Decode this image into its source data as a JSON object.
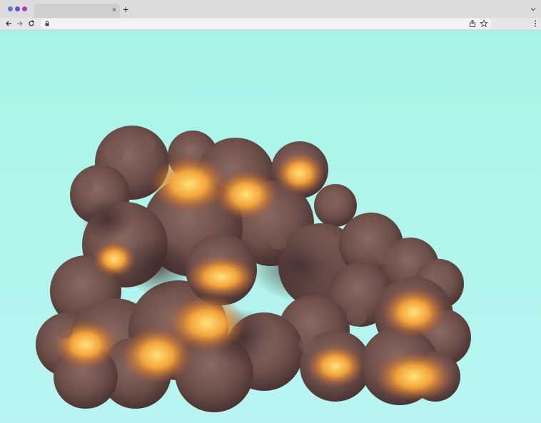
{
  "browser": {
    "tab_close_glyph": "×",
    "new_tab_glyph": "+",
    "traffic_colors": [
      "#4f7bd6",
      "#6a4ed0",
      "#b13ac9"
    ],
    "icons": {
      "back": "arrow-left-icon",
      "forward": "arrow-right-icon",
      "reload": "reload-icon",
      "lock": "lock-icon",
      "share": "share-icon",
      "bookmark": "star-icon",
      "menu": "kebab-menu-icon",
      "tab_list": "chevron-down-icon"
    }
  },
  "page": {
    "background_top": "#a6f4e6",
    "background_bottom": "#b8f5f2",
    "image": "explosion-smoke-cloud"
  }
}
